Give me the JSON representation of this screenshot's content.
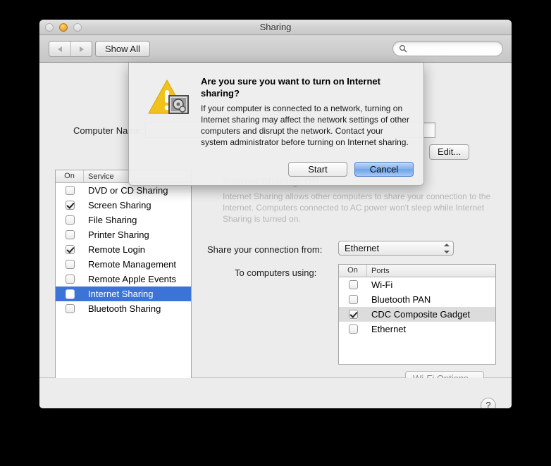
{
  "window": {
    "title": "Sharing",
    "traffic_lights": [
      "close",
      "minimize",
      "zoom"
    ]
  },
  "toolbar": {
    "back_label": "◀",
    "forward_label": "▶",
    "show_all_label": "Show All",
    "search_placeholder": "",
    "search_value": "",
    "search_icon": "search-icon"
  },
  "computer_name": {
    "label": "Computer Name:",
    "value": "",
    "edit_button": "Edit..."
  },
  "services_list": {
    "columns": [
      "On",
      "Service"
    ],
    "rows": [
      {
        "name": "DVD or CD Sharing",
        "checked": false,
        "selected": false
      },
      {
        "name": "Screen Sharing",
        "checked": true,
        "selected": false
      },
      {
        "name": "File Sharing",
        "checked": false,
        "selected": false
      },
      {
        "name": "Printer Sharing",
        "checked": false,
        "selected": false
      },
      {
        "name": "Remote Login",
        "checked": true,
        "selected": false
      },
      {
        "name": "Remote Management",
        "checked": false,
        "selected": false
      },
      {
        "name": "Remote Apple Events",
        "checked": false,
        "selected": false
      },
      {
        "name": "Internet Sharing",
        "checked": false,
        "selected": true
      },
      {
        "name": "Bluetooth Sharing",
        "checked": false,
        "selected": false
      }
    ]
  },
  "detail_pane": {
    "status_title": "Internet Sharing: Off",
    "description": "Internet Sharing allows other computers to share your connection to the Internet. Computers connected to AC power won't sleep while Internet Sharing is turned on.",
    "share_from_label": "Share your connection from:",
    "share_from_value": "Ethernet",
    "to_computers_label": "To computers using:",
    "wifi_options_button": "Wi-Fi Options..."
  },
  "ports_list": {
    "columns": [
      "On",
      "Ports"
    ],
    "rows": [
      {
        "name": "Wi-Fi",
        "checked": false,
        "selected": false
      },
      {
        "name": "Bluetooth PAN",
        "checked": false,
        "selected": false
      },
      {
        "name": "CDC Composite Gadget",
        "checked": true,
        "selected": true
      },
      {
        "name": "Ethernet",
        "checked": false,
        "selected": false
      }
    ]
  },
  "help_button": {
    "label": "?"
  },
  "sheet": {
    "icon": "warning-triangle-with-preferences-badge",
    "heading": "Are you sure you want to turn on Internet sharing?",
    "body": "If your computer is connected to a network, turning on Internet sharing may affect the network settings of other computers and disrupt the network. Contact your system administrator before turning on Internet sharing.",
    "primary_button": "Start",
    "default_button": "Cancel"
  },
  "colors": {
    "selection_blue": "#3b74d6",
    "selection_gray": "#dcdcdc",
    "warning_yellow": "#f5c518",
    "default_button_blue": "#7fb0ec"
  }
}
